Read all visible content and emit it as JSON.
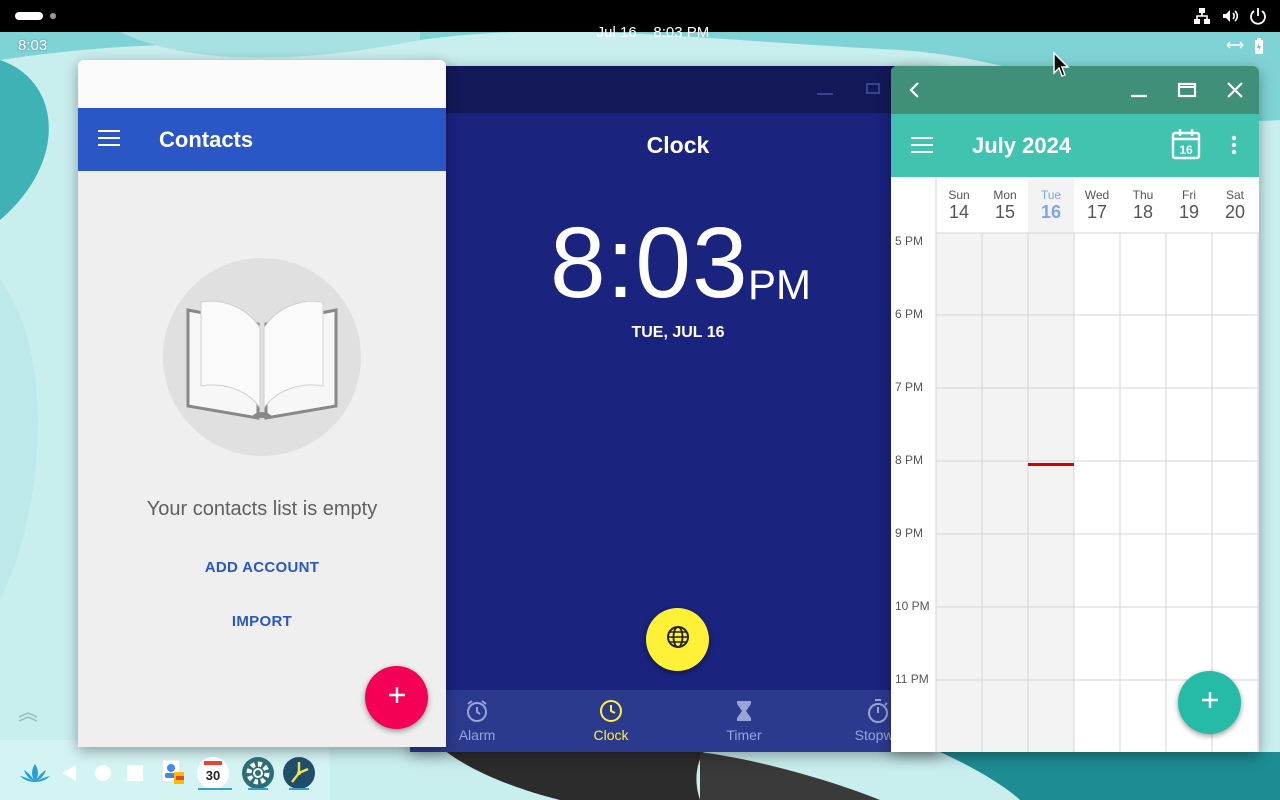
{
  "system_bar": {
    "date": "Jul 16",
    "time": "8:03 PM",
    "icons": [
      "network-icon",
      "volume-icon",
      "power-icon"
    ]
  },
  "status_row": {
    "time": "8:03",
    "icons": [
      "screen-resize-icon",
      "battery-icon"
    ]
  },
  "contacts_app": {
    "title": "Contacts",
    "empty_message": "Your contacts list is empty",
    "add_account_label": "ADD ACCOUNT",
    "import_label": "IMPORT",
    "fab_icon": "plus-icon",
    "accent_color": "#2a56c6",
    "fab_color": "#f50057"
  },
  "clock_app": {
    "title": "Clock",
    "time": "8:03",
    "ampm": "PM",
    "date": "TUE, JUL 16",
    "fab_icon": "globe-icon",
    "nav": [
      {
        "label": "Alarm",
        "icon": "alarm-icon",
        "active": false
      },
      {
        "label": "Clock",
        "icon": "clock-icon",
        "active": true
      },
      {
        "label": "Timer",
        "icon": "hourglass-icon",
        "active": false
      },
      {
        "label": "Stopwa",
        "icon": "stopwatch-icon",
        "active": false
      }
    ],
    "background_color": "#1a237e",
    "accent_color": "#fff136"
  },
  "calendar_app": {
    "title": "July 2024",
    "today_icon_day": "16",
    "days": [
      {
        "name": "Sun",
        "date": "14"
      },
      {
        "name": "Mon",
        "date": "15"
      },
      {
        "name": "Tue",
        "date": "16",
        "today": true
      },
      {
        "name": "Wed",
        "date": "17"
      },
      {
        "name": "Thu",
        "date": "18"
      },
      {
        "name": "Fri",
        "date": "19"
      },
      {
        "name": "Sat",
        "date": "20"
      }
    ],
    "hours": [
      "5 PM",
      "6 PM",
      "7 PM",
      "8 PM",
      "9 PM",
      "10 PM",
      "11 PM"
    ],
    "accent_color": "#41c3b0"
  },
  "taskbar": {
    "items": [
      "launcher-icon",
      "back-icon",
      "home-icon",
      "recents-icon",
      "contacts-app-icon",
      "calendar-app-icon",
      "settings-app-icon",
      "clock-app-icon"
    ],
    "calendar_icon_text": "30"
  }
}
